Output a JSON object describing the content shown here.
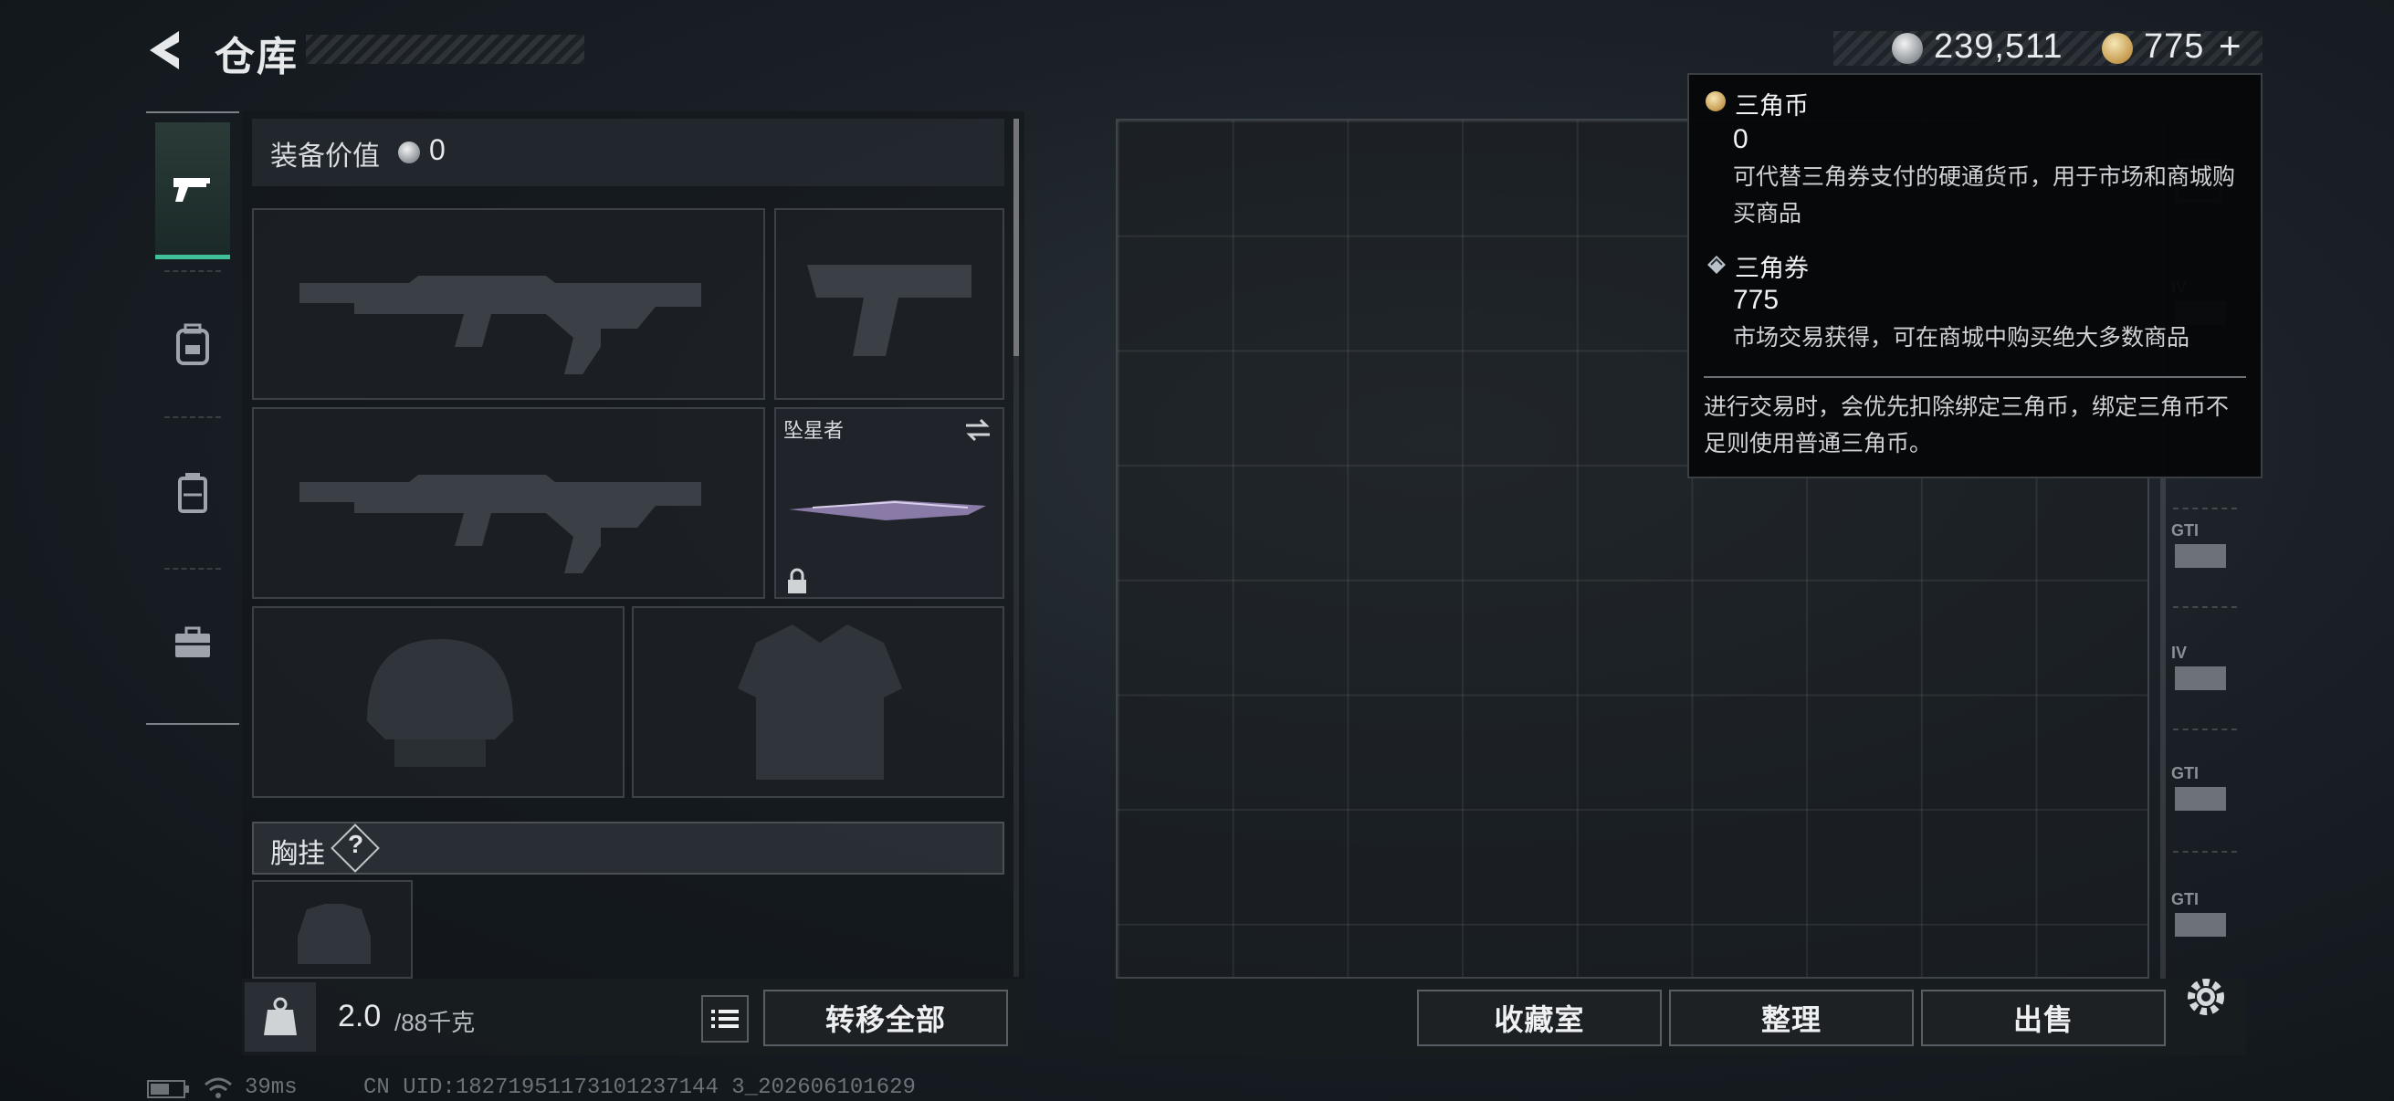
{
  "header": {
    "title": "仓库",
    "silver_amount": "239,511",
    "gold_amount": "775",
    "add_symbol": "+"
  },
  "tabs": [
    "weapon-tab",
    "backpack-tab",
    "locker-tab",
    "case-tab"
  ],
  "equipment": {
    "value_label": "装备价值",
    "value_amount": "0",
    "melee_name": "坠星者",
    "chest_label": "胸挂",
    "chest_help": "?"
  },
  "bottom_left": {
    "weight_current": "2.0",
    "weight_max": "/88千克",
    "transfer_all": "转移全部"
  },
  "bottom_right": {
    "collection": "收藏室",
    "organize": "整理",
    "sell": "出售"
  },
  "tooltip": {
    "coin_title": "三角币",
    "coin_value": "0",
    "coin_desc": "可代替三角券支付的硬通货币，用于市场和商城购买商品",
    "ticket_title": "三角券",
    "ticket_value": "775",
    "ticket_desc": "市场交易获得，可在商城中购买绝大多数商品",
    "footer": "进行交易时，会优先扣除绑定三角币，绑定三角币不足则使用普通三角币。"
  },
  "categories": [
    {
      "label": "IV"
    },
    {
      "label": "GTI"
    },
    {
      "label": "IV"
    },
    {
      "label": "GTI"
    },
    {
      "label": "GTI"
    }
  ],
  "status": {
    "ping": "39ms",
    "uid": "CN UID:18271951173101237144 3_202606101629"
  },
  "colors": {
    "accent": "#3fbf9a",
    "gold": "#c59b4f",
    "silver": "#9aa0a6"
  }
}
